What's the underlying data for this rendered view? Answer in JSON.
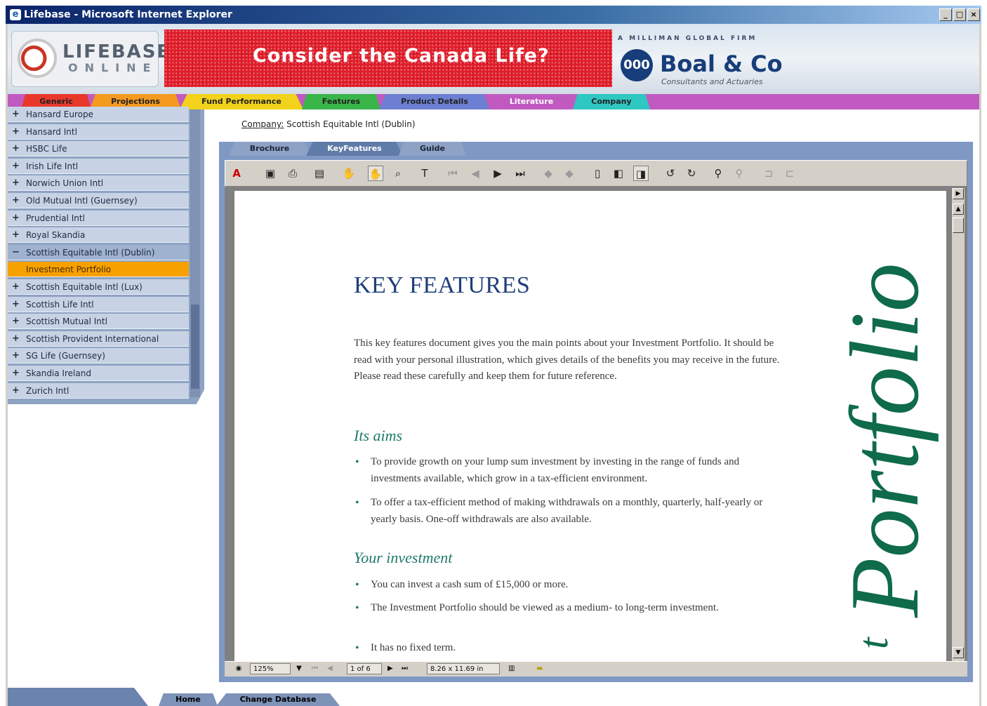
{
  "window": {
    "title": "Lifebase - Microsoft Internet Explorer",
    "controls": [
      "_",
      "□",
      "×"
    ]
  },
  "header": {
    "logo_line1": "LIFEBASE",
    "logo_line2": "ONLINE",
    "banner_text": "Consider the Canada Life?",
    "partner_tagline": "A MILLIMAN GLOBAL FIRM",
    "partner_mark": "000",
    "partner_name": "Boal & Co",
    "partner_sub": "Consultants and Actuaries"
  },
  "tabs": [
    {
      "label": "Generic",
      "color": "#e8382c"
    },
    {
      "label": "Projections",
      "color": "#f39a1f"
    },
    {
      "label": "Fund Performance",
      "color": "#f2d21b"
    },
    {
      "label": "Features",
      "color": "#39b54a"
    },
    {
      "label": "Product Details",
      "color": "#6c7fd2"
    },
    {
      "label": "Literature",
      "color": "#c05ac0",
      "active": true
    },
    {
      "label": "Company",
      "color": "#2fc7c2"
    }
  ],
  "sidebar": {
    "items": [
      {
        "sign": "+",
        "label": "Hansard Europe"
      },
      {
        "sign": "+",
        "label": "Hansard Intl"
      },
      {
        "sign": "+",
        "label": "HSBC Life"
      },
      {
        "sign": "+",
        "label": "Irish Life Intl"
      },
      {
        "sign": "+",
        "label": "Norwich Union Intl"
      },
      {
        "sign": "+",
        "label": "Old Mutual Intl (Guernsey)"
      },
      {
        "sign": "+",
        "label": "Prudential Intl"
      },
      {
        "sign": "+",
        "label": "Royal Skandia"
      },
      {
        "sign": "−",
        "label": "Scottish Equitable Intl (Dublin)",
        "expanded": true
      },
      {
        "sign": "",
        "label": "Investment Portfolio",
        "child": true
      },
      {
        "sign": "+",
        "label": "Scottish Equitable Intl (Lux)"
      },
      {
        "sign": "+",
        "label": "Scottish Life Intl"
      },
      {
        "sign": "+",
        "label": "Scottish Mutual Intl"
      },
      {
        "sign": "+",
        "label": "Scottish Provident International"
      },
      {
        "sign": "+",
        "label": "SG Life (Guernsey)"
      },
      {
        "sign": "+",
        "label": "Skandia Ireland"
      },
      {
        "sign": "+",
        "label": "Zurich Intl"
      }
    ]
  },
  "breadcrumb": {
    "link": "Company:",
    "text": "Scottish Equitable Intl (Dublin)"
  },
  "doc_tabs": [
    {
      "label": "Brochure"
    },
    {
      "label": "KeyFeatures",
      "active": true
    },
    {
      "label": "Guide"
    }
  ],
  "pdf_toolbar": {
    "icons": [
      "acrobat-icon",
      "save-icon",
      "print-icon",
      "page-view-icon",
      "hand-grab-icon",
      "hand-icon",
      "zoom-icon",
      "text-select-icon",
      "first-page-icon",
      "previous-page-icon",
      "next-page-icon",
      "last-page-icon",
      "back-icon",
      "forward-icon",
      "actual-size-icon",
      "fit-page-icon",
      "fit-width-icon",
      "rotate-left-icon",
      "rotate-right-icon",
      "find-icon",
      "find-next-icon",
      "column-select-icon",
      "graphics-select-icon"
    ]
  },
  "document": {
    "title": "KEY FEATURES",
    "intro": "This key features document gives you the main points about your Investment Portfolio. It should be read with your personal illustration, which gives details of the benefits you may receive in the future. Please read these carefully and keep them for future reference.",
    "section1_heading": "Its aims",
    "section1_bullets": [
      "To provide growth on your lump sum investment by investing in the range of funds and investments available, which grow in a tax-efficient environment.",
      "To offer a tax-efficient method of making withdrawals on a monthly, quarterly, half-yearly or yearly basis. One-off withdrawals are also available."
    ],
    "section2_heading": "Your investment",
    "section2_bullets": [
      "You can invest a cash sum of £15,000 or more.",
      "The Investment Portfolio  should be viewed as a medium- to long-term investment.",
      "It has no fixed term."
    ],
    "side_title": "Portfolio",
    "side_fragment": "t"
  },
  "pdf_status": {
    "zoom": "125%",
    "page": "1 of 6",
    "page_size": "8.26 x 11.69 in"
  },
  "bottom_nav": {
    "home": "Home",
    "change_db": "Change Database"
  }
}
